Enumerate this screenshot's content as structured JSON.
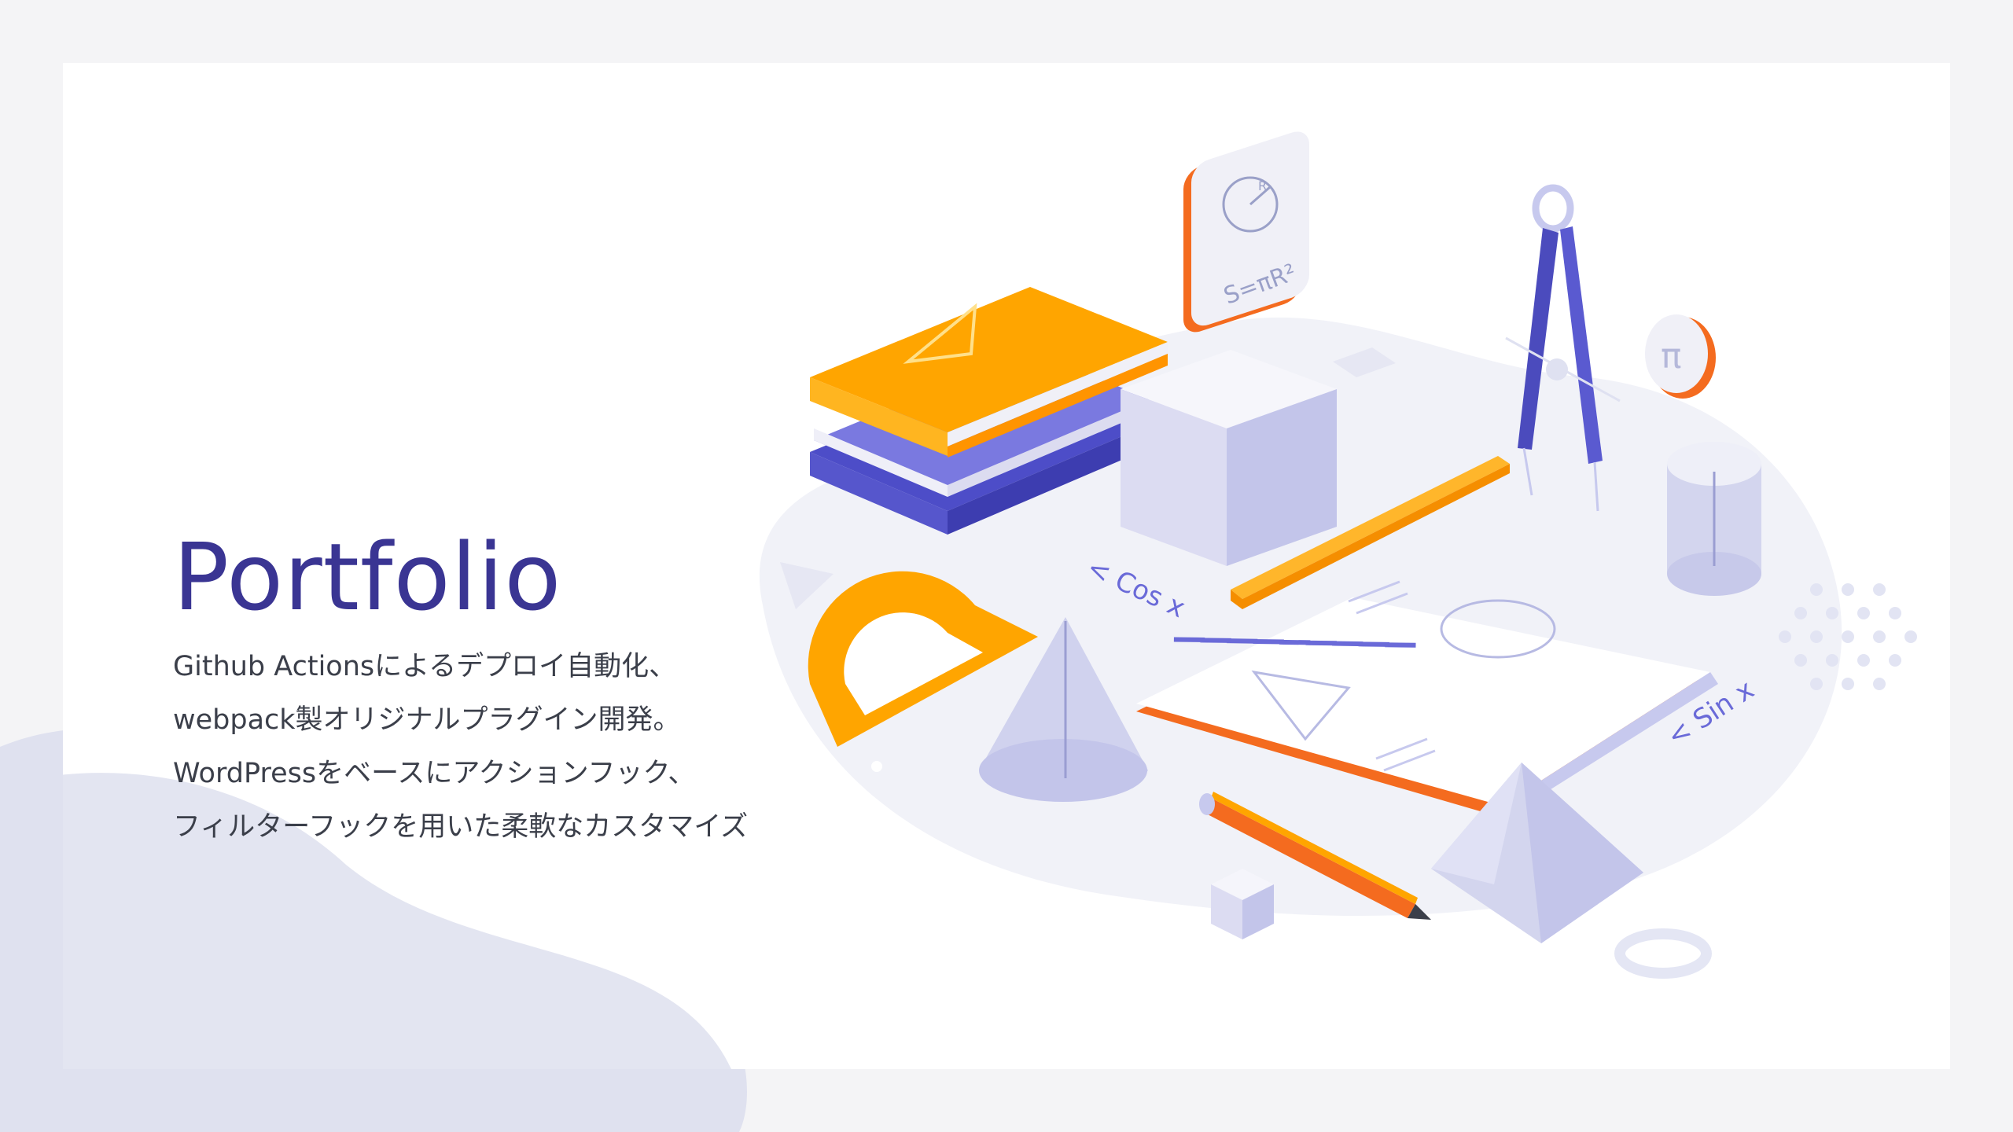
{
  "hero": {
    "title": "Portfolio",
    "description_lines": [
      "Github Actionsによるデプロイ自動化、",
      "webpack製オリジナルプラグイン開発。",
      "WordPressをベースにアクションフック、",
      "フィルターフックを用いた柔軟なカスタマイズ"
    ]
  },
  "illustration": {
    "card_formula": "S=πR²",
    "card_r_label": "R",
    "coin_symbol": "π",
    "cos_label": "< Cos x",
    "sin_label": "< Sin x"
  },
  "colors": {
    "title": "#3a3593",
    "text": "#3b3f4a",
    "accent_orange": "#ffa500",
    "accent_deep_orange": "#f46b1f",
    "accent_indigo": "#5150c8",
    "lavender": "#c7c9ee",
    "background": "#f4f4f6"
  },
  "icons": [
    "book-icon",
    "compass-icon",
    "ruler-icon",
    "protractor-icon",
    "pencil-icon",
    "notebook-icon",
    "cube-icon",
    "cone-icon",
    "cylinder-icon",
    "prism-icon"
  ]
}
